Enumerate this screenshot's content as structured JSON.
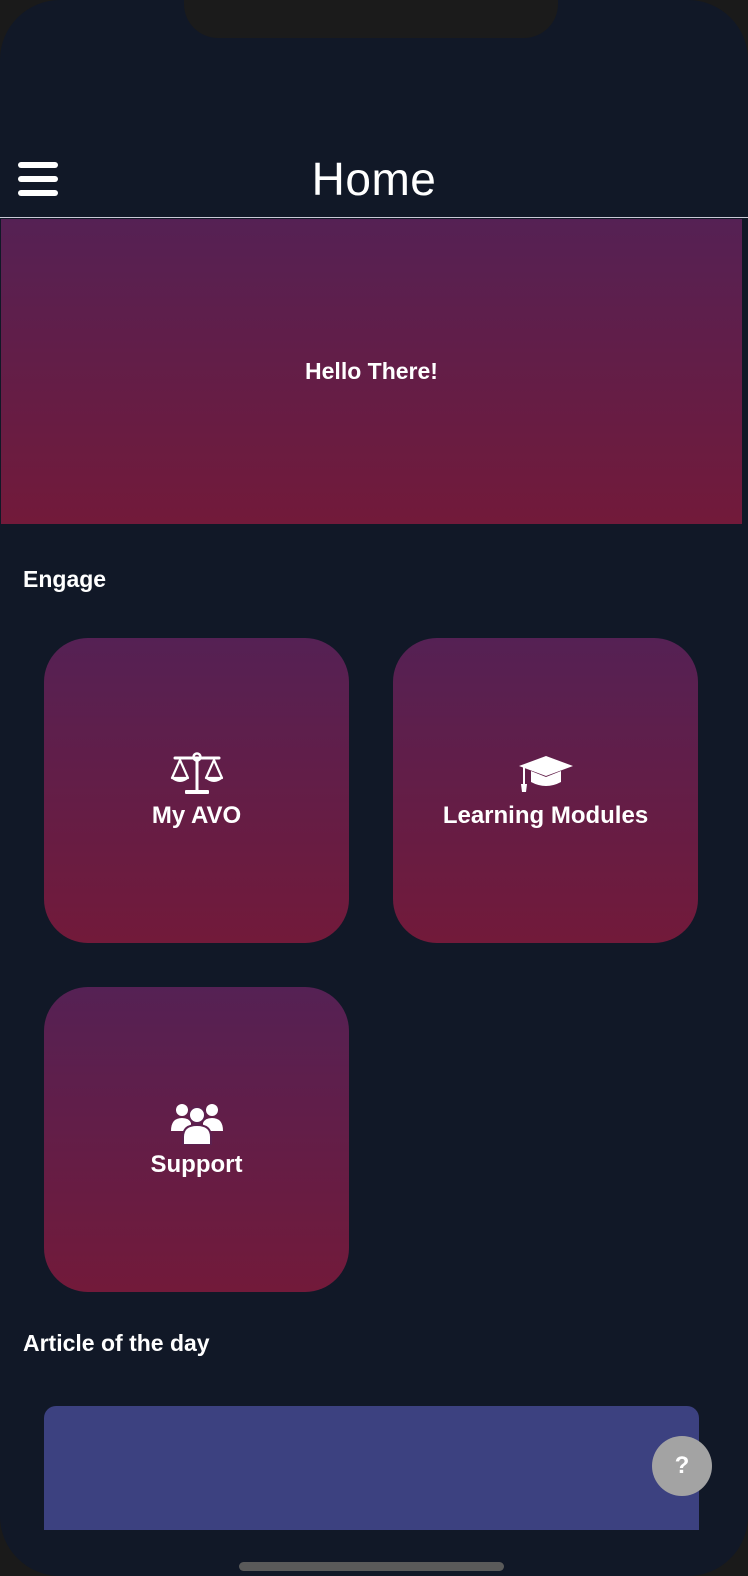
{
  "header": {
    "title": "Home",
    "menu_icon": "hamburger-menu-icon"
  },
  "hero": {
    "greeting": "Hello There!"
  },
  "engage": {
    "title": "Engage",
    "tiles": [
      {
        "label": "My AVO",
        "icon": "scales-icon"
      },
      {
        "label": "Learning Modules",
        "icon": "graduation-cap-icon"
      },
      {
        "label": "Support",
        "icon": "users-group-icon"
      }
    ]
  },
  "article": {
    "title": "Article of the day"
  },
  "help": {
    "label": "?"
  },
  "colors": {
    "background": "#111827",
    "gradient_top": "#552154",
    "gradient_bottom": "#721a3a",
    "article_card": "#3c4180",
    "help_button": "#a3a3a3"
  }
}
